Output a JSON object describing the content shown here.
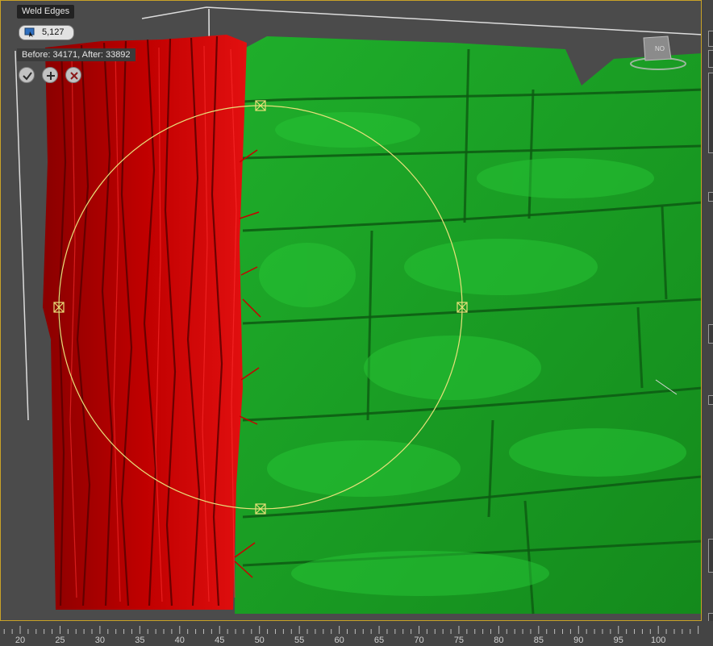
{
  "viewport": {
    "accent_border_color": "#c9a227",
    "red_mesh_color": "#b40000",
    "green_mesh_color": "#1a9a22",
    "gizmo_color": "#e8e07a"
  },
  "caddy": {
    "title": "Weld Edges",
    "threshold_value": "5,127",
    "threshold_icon": "spinner-icon",
    "info_text": "Before: 34171, After: 33892",
    "ok_icon": "checkmark-icon",
    "apply_icon": "plus-icon",
    "cancel_icon": "close-icon"
  },
  "viewcube": {
    "label": "NO"
  },
  "timeline": {
    "ticks": [
      "20",
      "25",
      "30",
      "35",
      "40",
      "45",
      "50",
      "55",
      "60",
      "65",
      "70",
      "75",
      "80",
      "85",
      "90",
      "95",
      "100"
    ]
  }
}
